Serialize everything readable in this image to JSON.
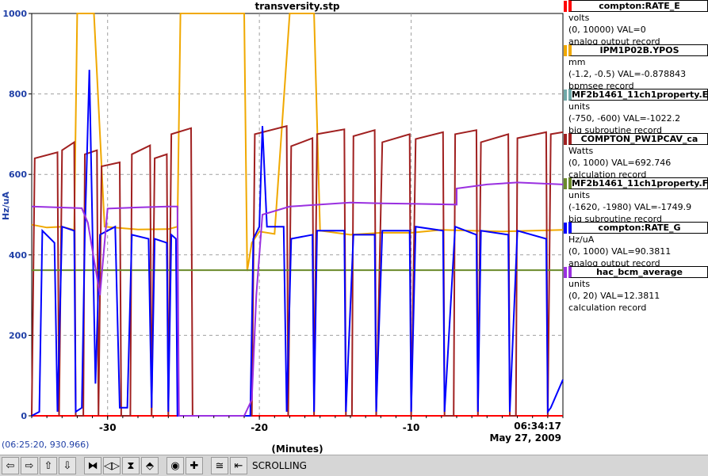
{
  "chart_data": {
    "type": "line",
    "title": "transversity.stp",
    "xlabel": "(Minutes)",
    "ylabel": "Hz/uA",
    "ylim": [
      0,
      1000
    ],
    "xlim": [
      -35,
      0
    ],
    "yticks": [
      0,
      200,
      400,
      600,
      800,
      1000
    ],
    "xticks": [
      -30,
      -20,
      -10
    ],
    "time_label": "06:34:17",
    "date_label": "May 27, 2009",
    "grid": true,
    "series": [
      {
        "name": "compton:RATE_E",
        "color": "#ff0000",
        "unit": "volts",
        "range": "(0, 10000) VAL=0",
        "record": "analog output record",
        "points": [
          [
            -35,
            0
          ],
          [
            0,
            0
          ]
        ]
      },
      {
        "name": "IPM1P02B.YPOS",
        "color": "#f0a800",
        "unit": "mm",
        "range": "(-1.2, -0.5) VAL=-0.878843",
        "record": "bpmsee record",
        "points": [
          [
            -35,
            475
          ],
          [
            -34,
            468
          ],
          [
            -33,
            470
          ],
          [
            -32.2,
            462
          ],
          [
            -32,
            1000
          ],
          [
            -31.6,
            1000
          ],
          [
            -31.2,
            1000
          ],
          [
            -30.9,
            1000
          ],
          [
            -30.2,
            470
          ],
          [
            -28,
            463
          ],
          [
            -26,
            464
          ],
          [
            -25.4,
            470
          ],
          [
            -25.2,
            1000
          ],
          [
            -25,
            1000
          ],
          [
            -24.5,
            1000
          ],
          [
            -21,
            1000
          ],
          [
            -20.8,
            360
          ],
          [
            -20.5,
            430
          ],
          [
            -20,
            458
          ],
          [
            -19,
            452
          ],
          [
            -18,
            1000
          ],
          [
            -17.6,
            1000
          ],
          [
            -16.4,
            1000
          ],
          [
            -16,
            460
          ],
          [
            -14,
            450
          ],
          [
            -12,
            455
          ],
          [
            -10,
            455
          ],
          [
            -8,
            462
          ],
          [
            -6,
            460
          ],
          [
            -4,
            458
          ],
          [
            -2,
            460
          ],
          [
            0,
            462
          ]
        ]
      },
      {
        "name": "MF2b1461_11ch1property.E",
        "color": "#70a8a8",
        "unit": "units",
        "range": "(-750, -600) VAL=-1022.2",
        "record": "big subroutine record",
        "points": []
      },
      {
        "name": "COMPTON_PW1PCAV_ca",
        "color": "#a02020",
        "unit": "Watts",
        "range": "(0, 1000) VAL=692.746",
        "record": "calculation record",
        "points": [
          [
            -35,
            0
          ],
          [
            -34.8,
            640
          ],
          [
            -33.3,
            655
          ],
          [
            -33.2,
            0
          ],
          [
            -33,
            660
          ],
          [
            -32.2,
            680
          ],
          [
            -32.1,
            0
          ],
          [
            -31.6,
            0
          ],
          [
            -31.5,
            650
          ],
          [
            -30.7,
            660
          ],
          [
            -30.6,
            0
          ],
          [
            -30.4,
            620
          ],
          [
            -29.2,
            630
          ],
          [
            -29.1,
            0
          ],
          [
            -28.5,
            0
          ],
          [
            -28.4,
            650
          ],
          [
            -27.2,
            672
          ],
          [
            -27.1,
            0
          ],
          [
            -26.9,
            640
          ],
          [
            -26.1,
            650
          ],
          [
            -26,
            0
          ],
          [
            -25.8,
            700
          ],
          [
            -24.5,
            715
          ],
          [
            -24.4,
            0
          ],
          [
            -20.5,
            0
          ],
          [
            -20.3,
            700
          ],
          [
            -18.2,
            720
          ],
          [
            -18.1,
            0
          ],
          [
            -17.9,
            670
          ],
          [
            -16.5,
            690
          ],
          [
            -16.4,
            0
          ],
          [
            -16.2,
            700
          ],
          [
            -14.4,
            712
          ],
          [
            -14.3,
            0
          ],
          [
            -13.9,
            0
          ],
          [
            -13.8,
            695
          ],
          [
            -12.4,
            710
          ],
          [
            -12.3,
            0
          ],
          [
            -11.9,
            680
          ],
          [
            -10.1,
            700
          ],
          [
            -10,
            0
          ],
          [
            -9.7,
            688
          ],
          [
            -7.9,
            705
          ],
          [
            -7.8,
            0
          ],
          [
            -7.2,
            0
          ],
          [
            -7.1,
            700
          ],
          [
            -5.7,
            710
          ],
          [
            -5.6,
            0
          ],
          [
            -5.4,
            680
          ],
          [
            -3.6,
            700
          ],
          [
            -3.5,
            0
          ],
          [
            -3.1,
            0
          ],
          [
            -3,
            690
          ],
          [
            -1.1,
            705
          ],
          [
            -1,
            0
          ],
          [
            -0.8,
            700
          ],
          [
            0,
            705
          ]
        ]
      },
      {
        "name": "MF2b1461_11ch1property.F",
        "color": "#6a8a2a",
        "unit": "units",
        "range": "(-1620, -1980)  VAL=-1749.9",
        "record": "big subroutine record",
        "points": [
          [
            -35,
            362
          ],
          [
            0,
            362
          ]
        ]
      },
      {
        "name": "compton:RATE_G",
        "color": "#0000ff",
        "unit": "Hz/uA",
        "range": "(0, 1000) VAL=90.3811",
        "record": "analog output record",
        "points": [
          [
            -35,
            0
          ],
          [
            -34.5,
            10
          ],
          [
            -34.3,
            460
          ],
          [
            -33.5,
            430
          ],
          [
            -33.3,
            10
          ],
          [
            -33,
            470
          ],
          [
            -32.2,
            460
          ],
          [
            -32.1,
            10
          ],
          [
            -31.7,
            20
          ],
          [
            -31.5,
            450
          ],
          [
            -31.2,
            860
          ],
          [
            -30.8,
            80
          ],
          [
            -30.5,
            450
          ],
          [
            -29.5,
            470
          ],
          [
            -29.2,
            20
          ],
          [
            -28.7,
            20
          ],
          [
            -28.4,
            450
          ],
          [
            -27.3,
            440
          ],
          [
            -27.1,
            20
          ],
          [
            -26.9,
            440
          ],
          [
            -26.1,
            430
          ],
          [
            -26,
            10
          ],
          [
            -25.8,
            450
          ],
          [
            -25.5,
            440
          ],
          [
            -25.4,
            0
          ],
          [
            -20.6,
            0
          ],
          [
            -20.4,
            440
          ],
          [
            -20,
            470
          ],
          [
            -19.8,
            720
          ],
          [
            -19.5,
            470
          ],
          [
            -18.4,
            470
          ],
          [
            -18.2,
            10
          ],
          [
            -17.9,
            440
          ],
          [
            -16.5,
            450
          ],
          [
            -16.4,
            10
          ],
          [
            -16.2,
            460
          ],
          [
            -14.4,
            460
          ],
          [
            -14.3,
            10
          ],
          [
            -13.8,
            450
          ],
          [
            -12.4,
            450
          ],
          [
            -12.3,
            10
          ],
          [
            -11.9,
            460
          ],
          [
            -10.1,
            460
          ],
          [
            -10,
            10
          ],
          [
            -9.7,
            470
          ],
          [
            -7.9,
            460
          ],
          [
            -7.8,
            10
          ],
          [
            -7.1,
            470
          ],
          [
            -5.7,
            450
          ],
          [
            -5.6,
            10
          ],
          [
            -5.4,
            460
          ],
          [
            -3.6,
            450
          ],
          [
            -3.5,
            10
          ],
          [
            -3,
            460
          ],
          [
            -1.1,
            440
          ],
          [
            -1,
            10
          ],
          [
            -0.8,
            20
          ],
          [
            0,
            90
          ]
        ]
      },
      {
        "name": "hac_bcm_average",
        "color": "#9a30e0",
        "unit": "units",
        "range": "(0, 20) VAL=12.3811",
        "record": "calculation record",
        "points": [
          [
            -35,
            520
          ],
          [
            -31.7,
            516
          ],
          [
            -31.3,
            480
          ],
          [
            -30.5,
            300
          ],
          [
            -30,
            515
          ],
          [
            -28,
            518
          ],
          [
            -26,
            520
          ],
          [
            -25.4,
            520
          ],
          [
            -25.3,
            0
          ],
          [
            -21,
            0
          ],
          [
            -20.5,
            40
          ],
          [
            -20.2,
            300
          ],
          [
            -19.8,
            500
          ],
          [
            -18,
            520
          ],
          [
            -16,
            525
          ],
          [
            -14,
            530
          ],
          [
            -12,
            528
          ],
          [
            -10,
            527
          ],
          [
            -7,
            525
          ],
          [
            -7,
            565
          ],
          [
            -5,
            575
          ],
          [
            -3,
            580
          ],
          [
            0,
            575
          ]
        ]
      }
    ]
  },
  "status": {
    "coordinates": "(06:25:20, 930.966)"
  },
  "toolbar": {
    "scrolling_label": "SCROLLING",
    "buttons": [
      {
        "icon": "arrow-left-icon",
        "glyph": "⇦"
      },
      {
        "icon": "arrow-right-icon",
        "glyph": "⇨"
      },
      {
        "icon": "arrow-up-icon",
        "glyph": "⇧"
      },
      {
        "icon": "arrow-down-icon",
        "glyph": "⇩"
      },
      {
        "icon": "zoom-in-x-icon",
        "glyph": "⧓"
      },
      {
        "icon": "zoom-out-x-icon",
        "glyph": "◁▷"
      },
      {
        "icon": "zoom-in-y-icon",
        "glyph": "⧗"
      },
      {
        "icon": "zoom-out-y-icon",
        "glyph": "⬘"
      },
      {
        "icon": "center-icon",
        "glyph": "◉"
      },
      {
        "icon": "crosshair-icon",
        "glyph": "✚"
      },
      {
        "icon": "auto-scale-icon",
        "glyph": "≅"
      },
      {
        "icon": "scroll-end-icon",
        "glyph": "⇤"
      }
    ]
  }
}
